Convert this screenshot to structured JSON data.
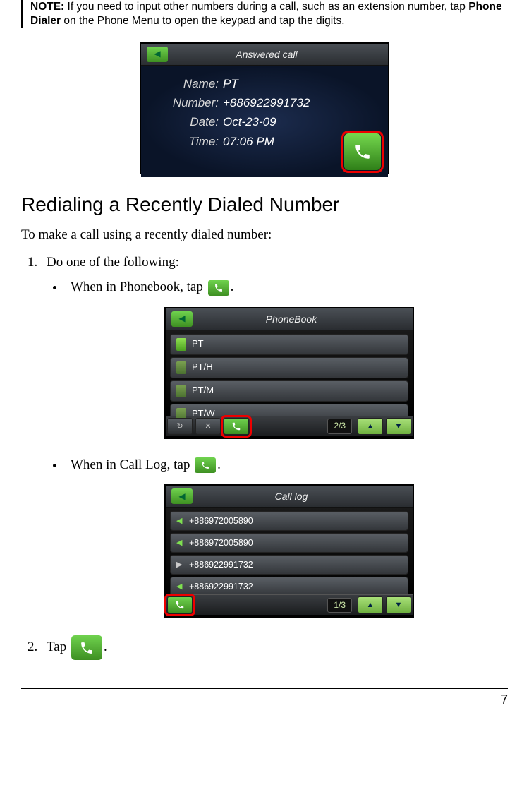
{
  "note": {
    "label": "NOTE:",
    "text_part1": " If you need to input other numbers during a call, such as an extension number, tap ",
    "bold_part": "Phone Dialer",
    "text_part2": " on the Phone Menu to open the keypad and tap the digits."
  },
  "answered_call": {
    "title": "Answered call",
    "name_label": "Name:",
    "name_value": "PT",
    "number_label": "Number:",
    "number_value": "+886922991732",
    "date_label": "Date:",
    "date_value": "Oct-23-09",
    "time_label": "Time:",
    "time_value": "07:06 PM"
  },
  "section_heading": "Redialing a Recently Dialed Number",
  "lead": "To make a call using a recently dialed number:",
  "step1": "Do one of the following:",
  "bullet1_pre": "When in Phonebook, tap ",
  "bullet1_post": ".",
  "bullet2_pre": "When in Call Log, tap ",
  "bullet2_post": ".",
  "step2_pre": "Tap ",
  "step2_post": ".",
  "phonebook": {
    "title": "PhoneBook",
    "entries": [
      "PT",
      "PT/H",
      "PT/M",
      "PT/W"
    ],
    "page": "2/3"
  },
  "calllog": {
    "title": "Call log",
    "entries": [
      {
        "dir": "in",
        "num": "+886972005890"
      },
      {
        "dir": "in",
        "num": "+886972005890"
      },
      {
        "dir": "out",
        "num": "+886922991732"
      },
      {
        "dir": "in",
        "num": "+886922991732"
      }
    ],
    "page": "1/3"
  },
  "page_number": "7"
}
